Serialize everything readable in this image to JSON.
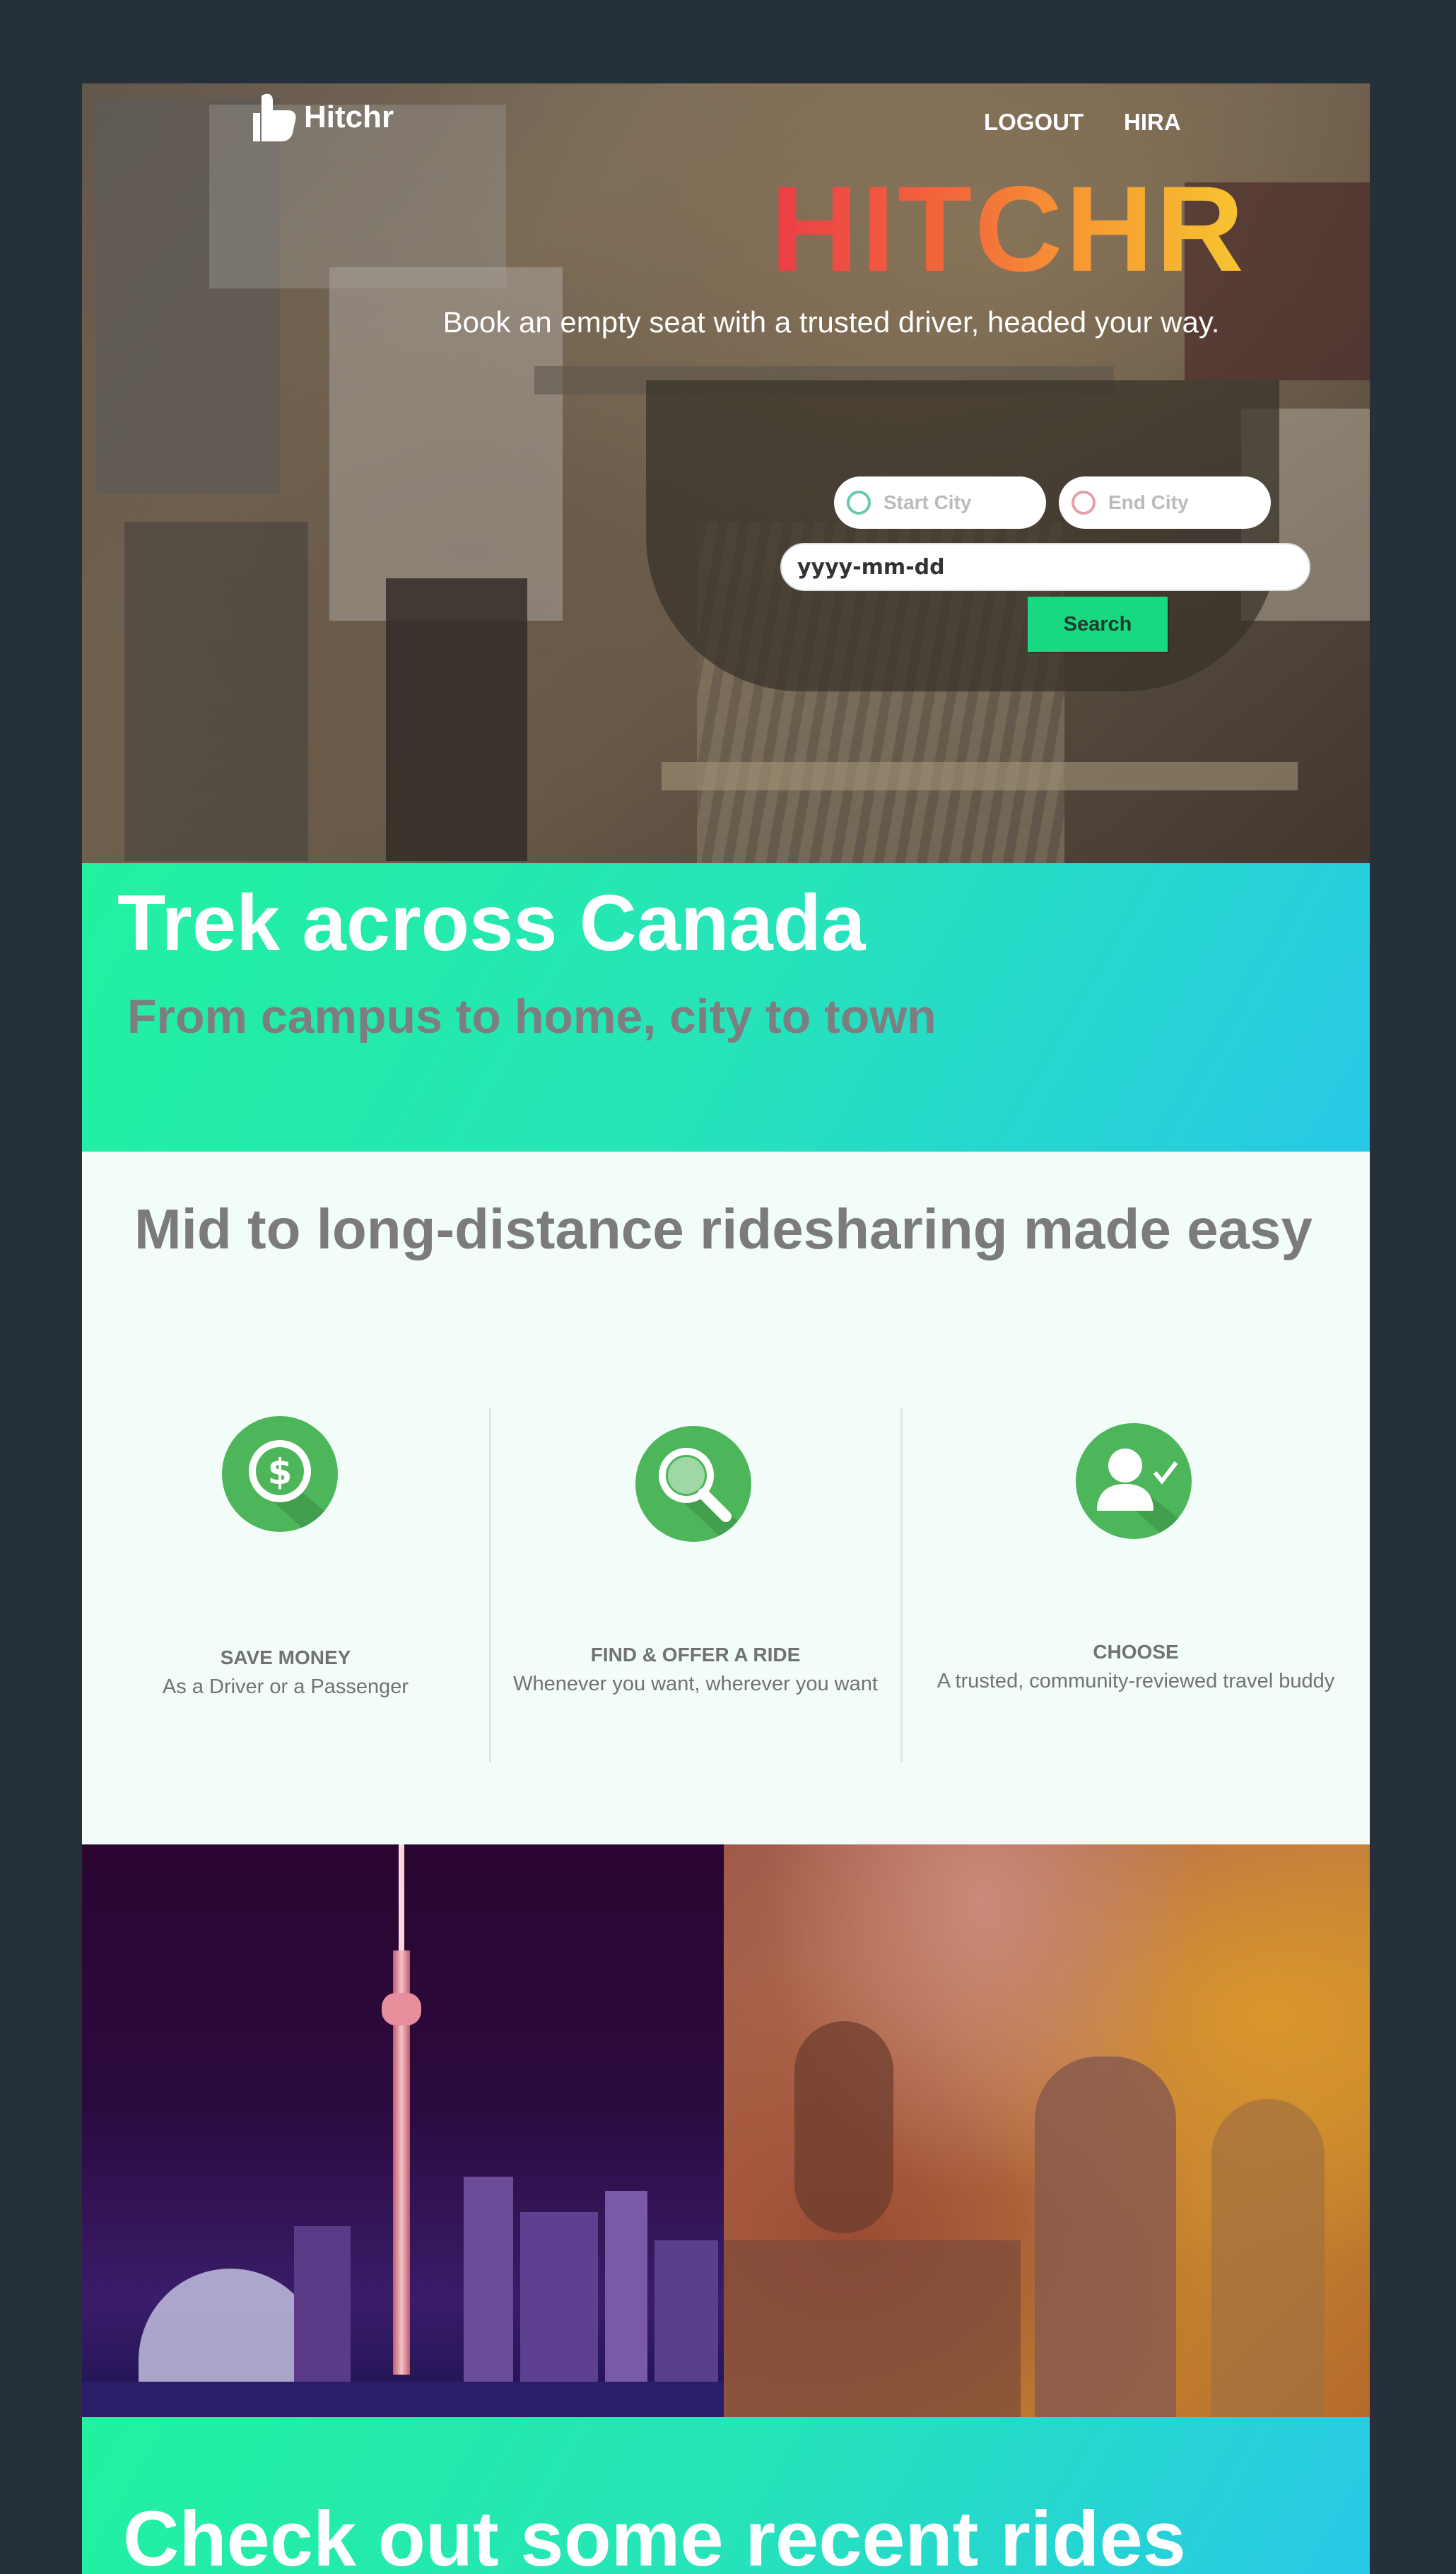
{
  "header": {
    "logo_text": "Hitchr",
    "nav": [
      "LOGOUT",
      "HIRA"
    ]
  },
  "hero": {
    "title": "HITCHR",
    "tagline": "Book an empty seat with a trusted driver, headed your way.",
    "search": {
      "start_placeholder": "Start City",
      "end_placeholder": "End City",
      "date_placeholder": "yyyy-mm-dd",
      "button_label": "Search"
    }
  },
  "trek": {
    "title": "Trek across Canada",
    "subtitle": "From campus to home, city to town"
  },
  "features": {
    "title": "Mid to long-distance ridesharing made easy",
    "items": [
      {
        "icon": "dollar-icon",
        "heading": "SAVE MONEY",
        "text": "As a Driver or a Passenger"
      },
      {
        "icon": "magnifier-icon",
        "heading": "FIND & OFFER A RIDE",
        "text": "Whenever you want, wherever you want"
      },
      {
        "icon": "user-check-icon",
        "heading": "CHOOSE",
        "text": "A trusted, community-reviewed travel buddy"
      }
    ]
  },
  "recent": {
    "title": "Check out some recent rides offered :"
  },
  "colors": {
    "accent_green": "#19d882",
    "icon_green": "#4eb65a",
    "page_bg": "#263038"
  }
}
